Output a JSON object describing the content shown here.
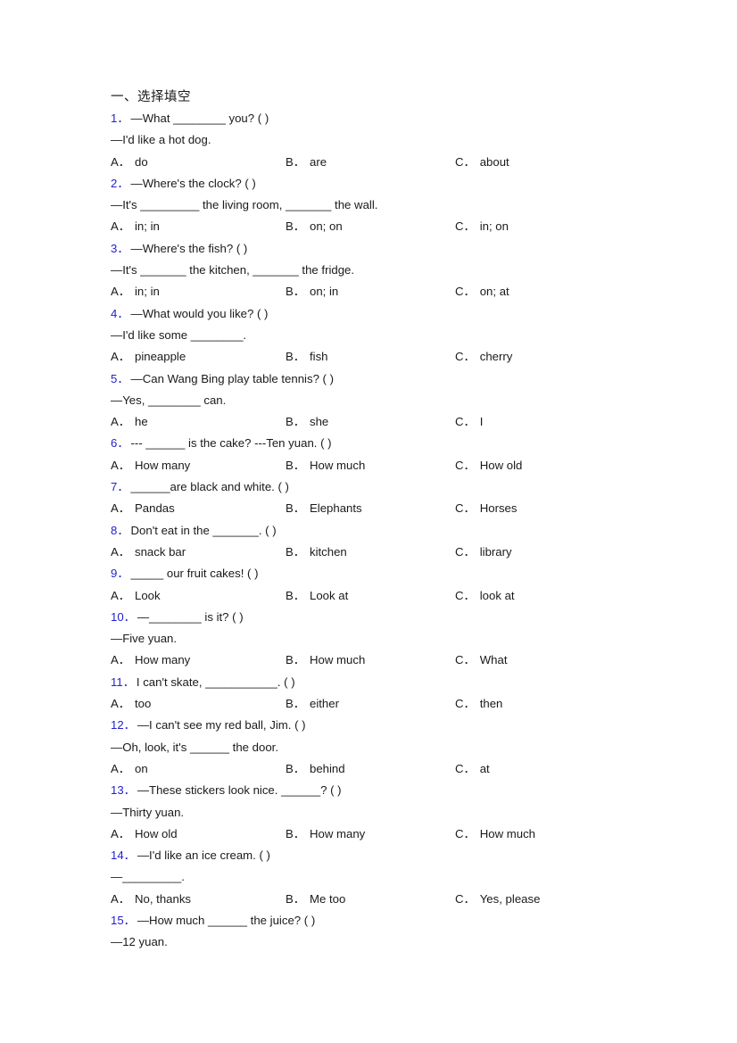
{
  "document": {
    "section_heading": "一、选择填空",
    "option_labels": {
      "a": "A．",
      "b": "B．",
      "c": "C．"
    },
    "accent_color": "#2222cc",
    "text_color": "#1a1a1a",
    "background_color": "#ffffff"
  },
  "questions": [
    {
      "number": "1．",
      "stem": "—What ________ you? (  )",
      "continuation": "—I'd like a hot dog.",
      "options": {
        "a": "do",
        "b": "are",
        "c": "about"
      }
    },
    {
      "number": "2．",
      "stem": "—Where's the clock? (  )",
      "continuation": "—It's _________ the living room, _______ the wall.",
      "options": {
        "a": "in; in",
        "b": "on; on",
        "c": "in; on"
      }
    },
    {
      "number": "3．",
      "stem": "—Where's the fish? (  )",
      "continuation": "—It's _______ the kitchen, _______ the fridge.",
      "options": {
        "a": "in; in",
        "b": "on; in",
        "c": "on; at"
      }
    },
    {
      "number": "4．",
      "stem": "—What would you like? (  )",
      "continuation": "—I'd like some ________.",
      "options": {
        "a": "pineapple",
        "b": "fish",
        "c": "cherry"
      }
    },
    {
      "number": "5．",
      "stem": "—Can Wang Bing play table tennis? (  )",
      "continuation": "—Yes, ________ can.",
      "options": {
        "a": "he",
        "b": "she",
        "c": "I"
      }
    },
    {
      "number": "6．",
      "stem": "--- ______ is the cake?  ---Ten yuan. (  )",
      "continuation": null,
      "options": {
        "a": "How many",
        "b": "How much",
        "c": "How old"
      }
    },
    {
      "number": "7．",
      "stem": "______are black and white. (  )",
      "continuation": null,
      "options": {
        "a": "Pandas",
        "b": "Elephants",
        "c": "Horses"
      }
    },
    {
      "number": "8．",
      "stem": "Don't eat in the _______. (  )",
      "continuation": null,
      "options": {
        "a": "snack bar",
        "b": "kitchen",
        "c": "library"
      }
    },
    {
      "number": "9．",
      "stem": "_____ our fruit cakes! (  )",
      "continuation": null,
      "options": {
        "a": "Look",
        "b": "Look at",
        "c": "look at"
      }
    },
    {
      "number": "10．",
      "stem": "—________ is it? (  )",
      "continuation": "—Five yuan.",
      "options": {
        "a": "How many",
        "b": "How much",
        "c": "What"
      }
    },
    {
      "number": "11．",
      "stem": "I can't skate, ___________. (  )",
      "continuation": null,
      "options": {
        "a": "too",
        "b": "either",
        "c": "then"
      }
    },
    {
      "number": "12．",
      "stem": "—I can't see my red ball, Jim. (  )",
      "continuation": "—Oh, look, it's ______ the door.",
      "options": {
        "a": "on",
        "b": "behind",
        "c": "at"
      }
    },
    {
      "number": "13．",
      "stem": "—These stickers look nice. ______? (  )",
      "continuation": "—Thirty yuan.",
      "options": {
        "a": "How old",
        "b": "How many",
        "c": "How much"
      }
    },
    {
      "number": "14．",
      "stem": "—I'd like an ice cream. (  )",
      "continuation": "—_________.",
      "options": {
        "a": "No, thanks",
        "b": "Me too",
        "c": "Yes, please"
      }
    },
    {
      "number": "15．",
      "stem": "—How much ______ the juice? (  )",
      "continuation": "—12 yuan.",
      "options": null
    }
  ]
}
